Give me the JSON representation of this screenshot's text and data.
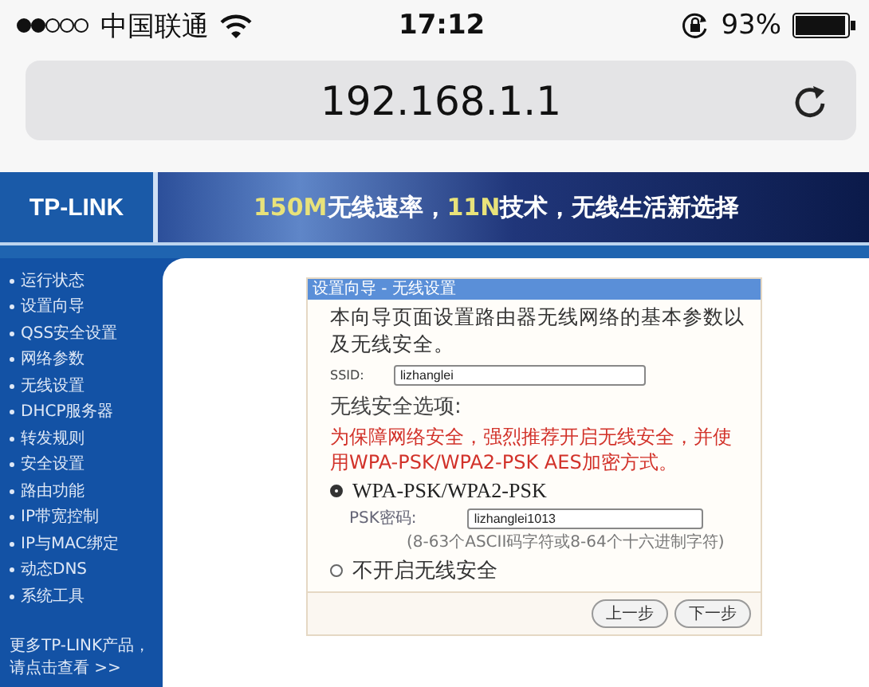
{
  "status_bar": {
    "carrier": "中国联通",
    "time": "17:12",
    "battery": "93%"
  },
  "address_bar": {
    "url": "192.168.1.1"
  },
  "header": {
    "logo": "TP-LINK",
    "banner": [
      {
        "text": "150M",
        "highlight": true
      },
      {
        "text": "无线速率，",
        "highlight": false
      },
      {
        "text": "11N",
        "highlight": true
      },
      {
        "text": "技术，无线生活新选择",
        "highlight": false
      }
    ]
  },
  "sidebar": {
    "items": [
      {
        "label": "运行状态"
      },
      {
        "label": "设置向导"
      },
      {
        "label": "QSS安全设置"
      },
      {
        "label": "网络参数"
      },
      {
        "label": "无线设置"
      },
      {
        "label": "DHCP服务器"
      },
      {
        "label": "转发规则"
      },
      {
        "label": "安全设置"
      },
      {
        "label": "路由功能"
      },
      {
        "label": "IP带宽控制"
      },
      {
        "label": "IP与MAC绑定"
      },
      {
        "label": "动态DNS"
      },
      {
        "label": "系统工具"
      }
    ],
    "footer": [
      "更多TP-LINK产品，",
      "请点击查看 >>"
    ]
  },
  "dialog": {
    "title": "设置向导 - 无线设置",
    "intro": "本向导页面设置路由器无线网络的基本参数以及无线安全。",
    "ssid": {
      "label": "SSID:",
      "value": "lizhanglei"
    },
    "security_heading": "无线安全选项:",
    "warning": "为保障网络安全，强烈推荐开启无线安全，并使用WPA-PSK/WPA2-PSK AES加密方式。",
    "options": [
      {
        "label": "WPA-PSK/WPA2-PSK",
        "selected": true,
        "password_label": "PSK密码:",
        "password": "lizhanglei1013",
        "hint": "(8-63个ASCII码字符或8-64个十六进制字符)"
      },
      {
        "label": "不开启无线安全",
        "selected": false
      }
    ],
    "buttons": [
      "上一步",
      "下一步"
    ]
  }
}
